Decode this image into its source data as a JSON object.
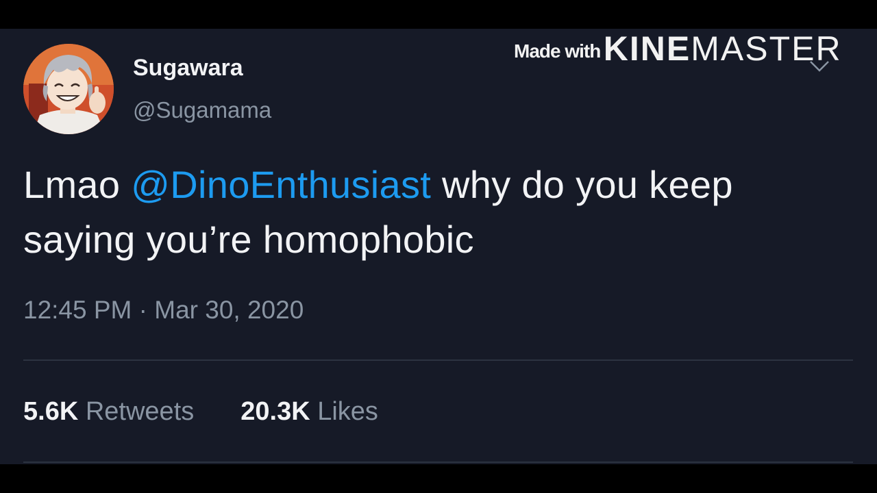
{
  "watermark": {
    "made_with": "Made with",
    "brand_bold": "KINE",
    "brand_regular": "MASTER"
  },
  "tweet": {
    "display_name": "Sugawara",
    "handle": "@Sugamama",
    "text_before": "Lmao ",
    "mention": "@DinoEnthusiast",
    "text_after": " why do you keep saying you’re homophobic",
    "timestamp": "12:45 PM · Mar 30, 2020",
    "stats": {
      "retweets_count": "5.6K",
      "retweets_label": "Retweets",
      "likes_count": "20.3K",
      "likes_label": "Likes"
    }
  },
  "colors": {
    "background": "#161a27",
    "letterbox": "#000000",
    "text_primary": "#f2f3f5",
    "text_secondary": "#8a95a3",
    "accent_link": "#1d9bf0",
    "divider": "#2c3341"
  },
  "icons": {
    "avatar": "anime-character-avatar",
    "menu": "chevron-down-icon"
  }
}
